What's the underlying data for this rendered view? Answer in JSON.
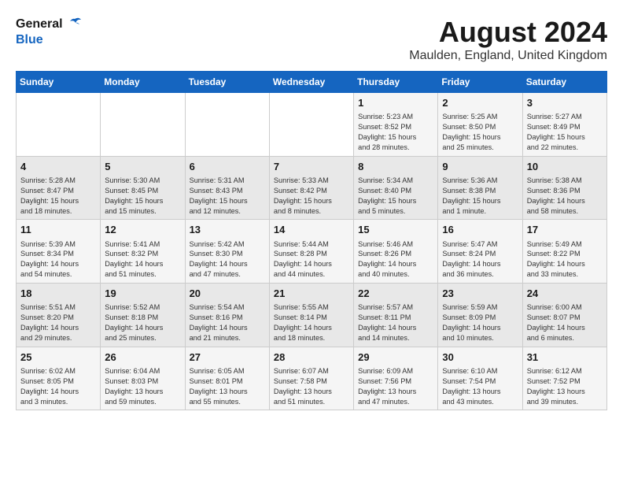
{
  "header": {
    "logo_text_general": "General",
    "logo_text_blue": "Blue",
    "month_year": "August 2024",
    "location": "Maulden, England, United Kingdom"
  },
  "calendar": {
    "headers": [
      "Sunday",
      "Monday",
      "Tuesday",
      "Wednesday",
      "Thursday",
      "Friday",
      "Saturday"
    ],
    "weeks": [
      [
        {
          "day": "",
          "content": ""
        },
        {
          "day": "",
          "content": ""
        },
        {
          "day": "",
          "content": ""
        },
        {
          "day": "",
          "content": ""
        },
        {
          "day": "1",
          "content": "Sunrise: 5:23 AM\nSunset: 8:52 PM\nDaylight: 15 hours\nand 28 minutes."
        },
        {
          "day": "2",
          "content": "Sunrise: 5:25 AM\nSunset: 8:50 PM\nDaylight: 15 hours\nand 25 minutes."
        },
        {
          "day": "3",
          "content": "Sunrise: 5:27 AM\nSunset: 8:49 PM\nDaylight: 15 hours\nand 22 minutes."
        }
      ],
      [
        {
          "day": "4",
          "content": "Sunrise: 5:28 AM\nSunset: 8:47 PM\nDaylight: 15 hours\nand 18 minutes."
        },
        {
          "day": "5",
          "content": "Sunrise: 5:30 AM\nSunset: 8:45 PM\nDaylight: 15 hours\nand 15 minutes."
        },
        {
          "day": "6",
          "content": "Sunrise: 5:31 AM\nSunset: 8:43 PM\nDaylight: 15 hours\nand 12 minutes."
        },
        {
          "day": "7",
          "content": "Sunrise: 5:33 AM\nSunset: 8:42 PM\nDaylight: 15 hours\nand 8 minutes."
        },
        {
          "day": "8",
          "content": "Sunrise: 5:34 AM\nSunset: 8:40 PM\nDaylight: 15 hours\nand 5 minutes."
        },
        {
          "day": "9",
          "content": "Sunrise: 5:36 AM\nSunset: 8:38 PM\nDaylight: 15 hours\nand 1 minute."
        },
        {
          "day": "10",
          "content": "Sunrise: 5:38 AM\nSunset: 8:36 PM\nDaylight: 14 hours\nand 58 minutes."
        }
      ],
      [
        {
          "day": "11",
          "content": "Sunrise: 5:39 AM\nSunset: 8:34 PM\nDaylight: 14 hours\nand 54 minutes."
        },
        {
          "day": "12",
          "content": "Sunrise: 5:41 AM\nSunset: 8:32 PM\nDaylight: 14 hours\nand 51 minutes."
        },
        {
          "day": "13",
          "content": "Sunrise: 5:42 AM\nSunset: 8:30 PM\nDaylight: 14 hours\nand 47 minutes."
        },
        {
          "day": "14",
          "content": "Sunrise: 5:44 AM\nSunset: 8:28 PM\nDaylight: 14 hours\nand 44 minutes."
        },
        {
          "day": "15",
          "content": "Sunrise: 5:46 AM\nSunset: 8:26 PM\nDaylight: 14 hours\nand 40 minutes."
        },
        {
          "day": "16",
          "content": "Sunrise: 5:47 AM\nSunset: 8:24 PM\nDaylight: 14 hours\nand 36 minutes."
        },
        {
          "day": "17",
          "content": "Sunrise: 5:49 AM\nSunset: 8:22 PM\nDaylight: 14 hours\nand 33 minutes."
        }
      ],
      [
        {
          "day": "18",
          "content": "Sunrise: 5:51 AM\nSunset: 8:20 PM\nDaylight: 14 hours\nand 29 minutes."
        },
        {
          "day": "19",
          "content": "Sunrise: 5:52 AM\nSunset: 8:18 PM\nDaylight: 14 hours\nand 25 minutes."
        },
        {
          "day": "20",
          "content": "Sunrise: 5:54 AM\nSunset: 8:16 PM\nDaylight: 14 hours\nand 21 minutes."
        },
        {
          "day": "21",
          "content": "Sunrise: 5:55 AM\nSunset: 8:14 PM\nDaylight: 14 hours\nand 18 minutes."
        },
        {
          "day": "22",
          "content": "Sunrise: 5:57 AM\nSunset: 8:11 PM\nDaylight: 14 hours\nand 14 minutes."
        },
        {
          "day": "23",
          "content": "Sunrise: 5:59 AM\nSunset: 8:09 PM\nDaylight: 14 hours\nand 10 minutes."
        },
        {
          "day": "24",
          "content": "Sunrise: 6:00 AM\nSunset: 8:07 PM\nDaylight: 14 hours\nand 6 minutes."
        }
      ],
      [
        {
          "day": "25",
          "content": "Sunrise: 6:02 AM\nSunset: 8:05 PM\nDaylight: 14 hours\nand 3 minutes."
        },
        {
          "day": "26",
          "content": "Sunrise: 6:04 AM\nSunset: 8:03 PM\nDaylight: 13 hours\nand 59 minutes."
        },
        {
          "day": "27",
          "content": "Sunrise: 6:05 AM\nSunset: 8:01 PM\nDaylight: 13 hours\nand 55 minutes."
        },
        {
          "day": "28",
          "content": "Sunrise: 6:07 AM\nSunset: 7:58 PM\nDaylight: 13 hours\nand 51 minutes."
        },
        {
          "day": "29",
          "content": "Sunrise: 6:09 AM\nSunset: 7:56 PM\nDaylight: 13 hours\nand 47 minutes."
        },
        {
          "day": "30",
          "content": "Sunrise: 6:10 AM\nSunset: 7:54 PM\nDaylight: 13 hours\nand 43 minutes."
        },
        {
          "day": "31",
          "content": "Sunrise: 6:12 AM\nSunset: 7:52 PM\nDaylight: 13 hours\nand 39 minutes."
        }
      ]
    ]
  }
}
